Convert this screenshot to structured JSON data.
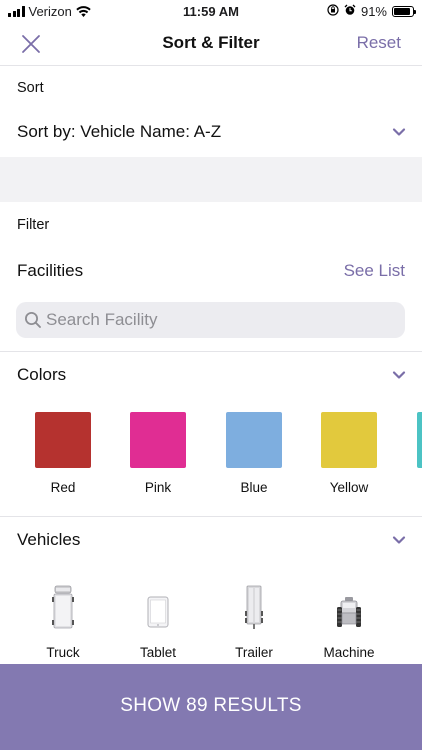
{
  "status_bar": {
    "carrier": "Verizon",
    "time": "11:59 AM",
    "battery": "91%",
    "battery_level": 0.91
  },
  "nav": {
    "title": "Sort & Filter",
    "reset_label": "Reset",
    "close_icon": "close-icon"
  },
  "sort": {
    "section_label": "Sort",
    "value": "Sort by: Vehicle Name: A-Z"
  },
  "filter": {
    "section_label": "Filter",
    "facilities": {
      "title": "Facilities",
      "see_list_label": "See List",
      "search_placeholder": "Search Facility",
      "search_value": ""
    },
    "colors": {
      "title": "Colors",
      "items": [
        {
          "label": "Red",
          "color": "#b5322f"
        },
        {
          "label": "Pink",
          "color": "#e02d93"
        },
        {
          "label": "Blue",
          "color": "#7eaedf"
        },
        {
          "label": "Yellow",
          "color": "#e2c93d"
        },
        {
          "label": "",
          "color": "#4cc3c4"
        }
      ]
    },
    "vehicles": {
      "title": "Vehicles",
      "items": [
        {
          "label": "Truck",
          "icon": "truck-icon"
        },
        {
          "label": "Tablet",
          "icon": "tablet-icon"
        },
        {
          "label": "Trailer",
          "icon": "trailer-icon"
        },
        {
          "label": "Machine",
          "icon": "machine-icon"
        }
      ]
    }
  },
  "footer": {
    "show_results_label": "SHOW 89 RESULTS"
  },
  "theme": {
    "accent": "#7a6ea8",
    "button_bg": "#8379b1"
  }
}
